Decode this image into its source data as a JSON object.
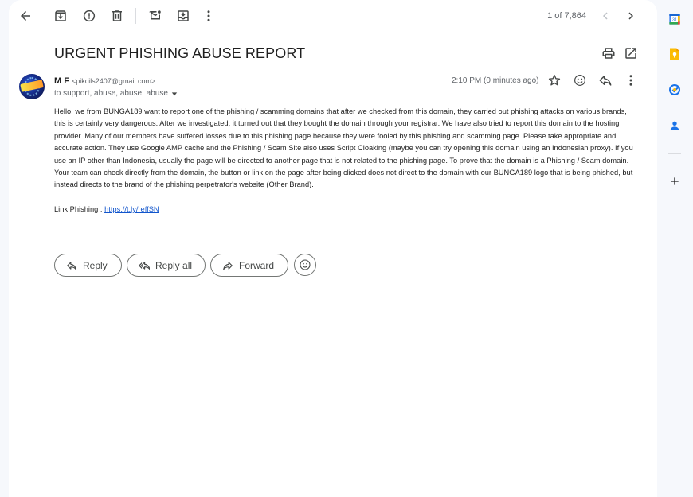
{
  "toolbar": {
    "counter": "1 of 7,864",
    "icons": [
      "back-arrow-icon",
      "archive-icon",
      "report-spam-icon",
      "delete-icon",
      "mark-unread-icon",
      "move-to-icon",
      "more-vert-icon",
      "newer-chevron-icon",
      "older-chevron-icon"
    ]
  },
  "email": {
    "subject": "URGENT PHISHING ABUSE REPORT",
    "sender_name": "M F",
    "sender_email": "<pikcils2407@gmail.com>",
    "recipients": "to support, abuse, abuse, abuse",
    "time": "2:10 PM (0 minutes ago)",
    "body": "Hello, we from BUNGA189 want to report one of the phishing / scamming domains that after we checked from this domain, they carried out phishing attacks on various brands, this is certainly very dangerous. After we investigated, it turned out that they bought the domain through your registrar. We have also tried to report this domain to the hosting provider. Many of our members have suffered losses due to this phishing page because they were fooled by this phishing and scamming page. Please take appropriate and accurate action. They use Google AMP cache and the Phishing / Scam Site also uses Script Cloaking (maybe you can try opening this domain using an Indonesian proxy). If you use an IP other than Indonesia, usually the page will be directed to another page that is not related to the phishing page. To prove that the domain is a Phishing / Scam domain. Your team can check directly from the domain, the button or link on the page after being clicked does not direct to the domain with our BUNGA189 logo that is being phished, but instead directs to the brand of the phishing perpetrator's website (Other Brand).",
    "link_label": "Link Phishing : ",
    "link_url": "https://t.ly/reffSN"
  },
  "actions": {
    "reply": "Reply",
    "reply_all": "Reply all",
    "forward": "Forward"
  },
  "side_panel": {
    "apps": [
      "calendar-icon",
      "keep-icon",
      "tasks-icon",
      "contacts-icon",
      "add-icon"
    ]
  },
  "colors": {
    "accent_blue": "#1155cc",
    "keep_yellow": "#fbbc04",
    "tasks_blue": "#1a73e8"
  }
}
